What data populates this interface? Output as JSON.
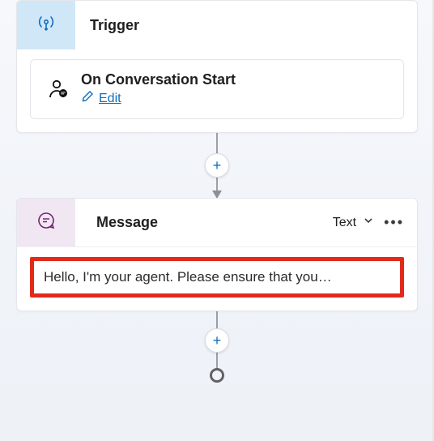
{
  "trigger_node": {
    "title": "Trigger",
    "sub": {
      "title": "On Conversation Start",
      "edit_label": "Edit"
    }
  },
  "message_node": {
    "title": "Message",
    "type_label": "Text",
    "content": "Hello, I'm your agent. Please ensure that you…"
  },
  "glyphs": {
    "plus": "+",
    "more": "•••"
  }
}
